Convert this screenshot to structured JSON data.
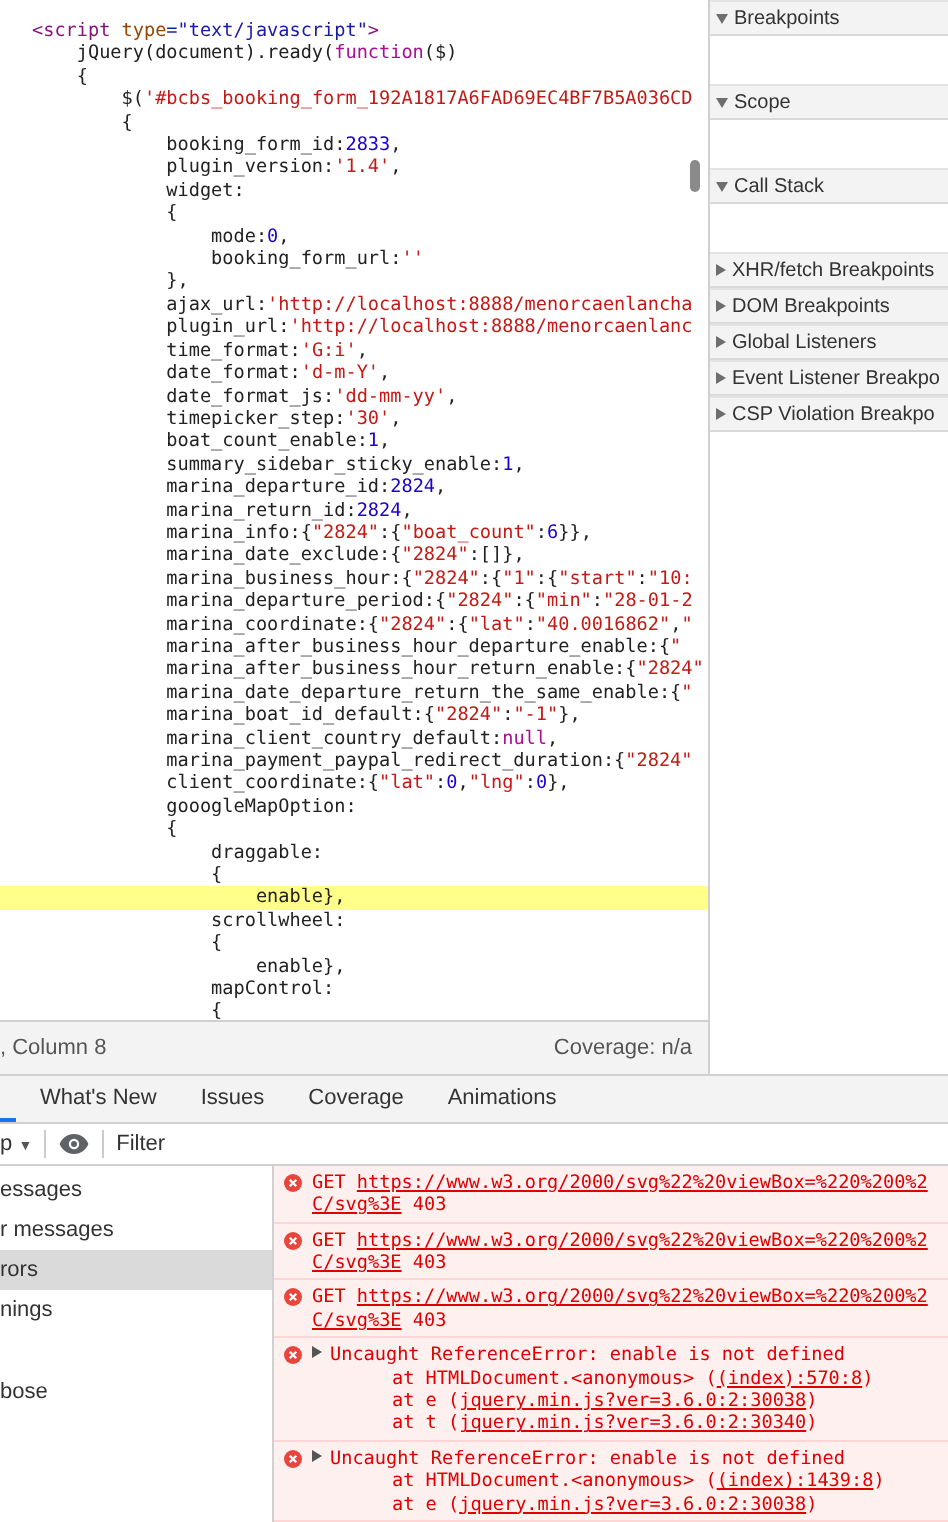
{
  "editor": {
    "lines": [
      {
        "highlighted": false,
        "tokens": [
          {
            "kind": "tag",
            "text": "<script "
          },
          {
            "kind": "attr",
            "text": "type"
          },
          {
            "kind": "attrval",
            "text": "=\"text/javascript\""
          },
          {
            "kind": "tag",
            "text": ">"
          }
        ]
      },
      {
        "highlighted": false,
        "tokens": [
          {
            "kind": "plain",
            "text": "    jQuery(document).ready("
          },
          {
            "kind": "kw",
            "text": "function"
          },
          {
            "kind": "plain",
            "text": "($)"
          }
        ]
      },
      {
        "highlighted": false,
        "tokens": [
          {
            "kind": "plain",
            "text": "    {"
          }
        ]
      },
      {
        "highlighted": false,
        "tokens": [
          {
            "kind": "plain",
            "text": "        $("
          },
          {
            "kind": "str",
            "text": "'#bcbs_booking_form_192A1817A6FAD69EC4BF7B5A036CD"
          }
        ]
      },
      {
        "highlighted": false,
        "tokens": [
          {
            "kind": "plain",
            "text": "        {"
          }
        ]
      },
      {
        "highlighted": false,
        "tokens": [
          {
            "kind": "plain",
            "text": "            booking_form_id:"
          },
          {
            "kind": "num",
            "text": "2833"
          },
          {
            "kind": "plain",
            "text": ","
          }
        ]
      },
      {
        "highlighted": false,
        "tokens": [
          {
            "kind": "plain",
            "text": "            plugin_version:"
          },
          {
            "kind": "str",
            "text": "'1.4'"
          },
          {
            "kind": "plain",
            "text": ","
          }
        ]
      },
      {
        "highlighted": false,
        "tokens": [
          {
            "kind": "plain",
            "text": "            widget:"
          }
        ]
      },
      {
        "highlighted": false,
        "tokens": [
          {
            "kind": "plain",
            "text": "            {"
          }
        ]
      },
      {
        "highlighted": false,
        "tokens": [
          {
            "kind": "plain",
            "text": "                mode:"
          },
          {
            "kind": "num",
            "text": "0"
          },
          {
            "kind": "plain",
            "text": ","
          }
        ]
      },
      {
        "highlighted": false,
        "tokens": [
          {
            "kind": "plain",
            "text": "                booking_form_url:"
          },
          {
            "kind": "str",
            "text": "''"
          }
        ]
      },
      {
        "highlighted": false,
        "tokens": [
          {
            "kind": "plain",
            "text": "            },"
          }
        ]
      },
      {
        "highlighted": false,
        "tokens": [
          {
            "kind": "plain",
            "text": "            ajax_url:"
          },
          {
            "kind": "str",
            "text": "'http://localhost:8888/menorcaenlancha"
          }
        ]
      },
      {
        "highlighted": false,
        "tokens": [
          {
            "kind": "plain",
            "text": "            plugin_url:"
          },
          {
            "kind": "str",
            "text": "'http://localhost:8888/menorcaenlanc"
          }
        ]
      },
      {
        "highlighted": false,
        "tokens": [
          {
            "kind": "plain",
            "text": "            time_format:"
          },
          {
            "kind": "str",
            "text": "'G:i'"
          },
          {
            "kind": "plain",
            "text": ","
          }
        ]
      },
      {
        "highlighted": false,
        "tokens": [
          {
            "kind": "plain",
            "text": "            date_format:"
          },
          {
            "kind": "str",
            "text": "'d-m-Y'"
          },
          {
            "kind": "plain",
            "text": ","
          }
        ]
      },
      {
        "highlighted": false,
        "tokens": [
          {
            "kind": "plain",
            "text": "            date_format_js:"
          },
          {
            "kind": "str",
            "text": "'dd-mm-yy'"
          },
          {
            "kind": "plain",
            "text": ","
          }
        ]
      },
      {
        "highlighted": false,
        "tokens": [
          {
            "kind": "plain",
            "text": "            timepicker_step:"
          },
          {
            "kind": "str",
            "text": "'30'"
          },
          {
            "kind": "plain",
            "text": ","
          }
        ]
      },
      {
        "highlighted": false,
        "tokens": [
          {
            "kind": "plain",
            "text": "            boat_count_enable:"
          },
          {
            "kind": "num",
            "text": "1"
          },
          {
            "kind": "plain",
            "text": ","
          }
        ]
      },
      {
        "highlighted": false,
        "tokens": [
          {
            "kind": "plain",
            "text": "            summary_sidebar_sticky_enable:"
          },
          {
            "kind": "num",
            "text": "1"
          },
          {
            "kind": "plain",
            "text": ","
          }
        ]
      },
      {
        "highlighted": false,
        "tokens": [
          {
            "kind": "plain",
            "text": "            marina_departure_id:"
          },
          {
            "kind": "num",
            "text": "2824"
          },
          {
            "kind": "plain",
            "text": ","
          }
        ]
      },
      {
        "highlighted": false,
        "tokens": [
          {
            "kind": "plain",
            "text": "            marina_return_id:"
          },
          {
            "kind": "num",
            "text": "2824"
          },
          {
            "kind": "plain",
            "text": ","
          }
        ]
      },
      {
        "highlighted": false,
        "tokens": [
          {
            "kind": "plain",
            "text": "            marina_info:{"
          },
          {
            "kind": "str",
            "text": "\"2824\""
          },
          {
            "kind": "plain",
            "text": ":{"
          },
          {
            "kind": "str",
            "text": "\"boat_count\""
          },
          {
            "kind": "plain",
            "text": ":"
          },
          {
            "kind": "num",
            "text": "6"
          },
          {
            "kind": "plain",
            "text": "}},"
          }
        ]
      },
      {
        "highlighted": false,
        "tokens": [
          {
            "kind": "plain",
            "text": "            marina_date_exclude:{"
          },
          {
            "kind": "str",
            "text": "\"2824\""
          },
          {
            "kind": "plain",
            "text": ":[]},"
          }
        ]
      },
      {
        "highlighted": false,
        "tokens": [
          {
            "kind": "plain",
            "text": "            marina_business_hour:{"
          },
          {
            "kind": "str",
            "text": "\"2824\""
          },
          {
            "kind": "plain",
            "text": ":{"
          },
          {
            "kind": "str",
            "text": "\"1\""
          },
          {
            "kind": "plain",
            "text": ":{"
          },
          {
            "kind": "str",
            "text": "\"start\""
          },
          {
            "kind": "plain",
            "text": ":"
          },
          {
            "kind": "str",
            "text": "\"10:"
          }
        ]
      },
      {
        "highlighted": false,
        "tokens": [
          {
            "kind": "plain",
            "text": "            marina_departure_period:{"
          },
          {
            "kind": "str",
            "text": "\"2824\""
          },
          {
            "kind": "plain",
            "text": ":{"
          },
          {
            "kind": "str",
            "text": "\"min\""
          },
          {
            "kind": "plain",
            "text": ":"
          },
          {
            "kind": "str",
            "text": "\"28-01-2"
          }
        ]
      },
      {
        "highlighted": false,
        "tokens": [
          {
            "kind": "plain",
            "text": "            marina_coordinate:{"
          },
          {
            "kind": "str",
            "text": "\"2824\""
          },
          {
            "kind": "plain",
            "text": ":{"
          },
          {
            "kind": "str",
            "text": "\"lat\""
          },
          {
            "kind": "plain",
            "text": ":"
          },
          {
            "kind": "str",
            "text": "\"40.0016862\""
          },
          {
            "kind": "plain",
            "text": ","
          },
          {
            "kind": "str",
            "text": "\""
          }
        ]
      },
      {
        "highlighted": false,
        "tokens": [
          {
            "kind": "plain",
            "text": "            marina_after_business_hour_departure_enable:{"
          },
          {
            "kind": "str",
            "text": "\""
          }
        ]
      },
      {
        "highlighted": false,
        "tokens": [
          {
            "kind": "plain",
            "text": "            marina_after_business_hour_return_enable:{"
          },
          {
            "kind": "str",
            "text": "\"2824\""
          }
        ]
      },
      {
        "highlighted": false,
        "tokens": [
          {
            "kind": "plain",
            "text": "            marina_date_departure_return_the_same_enable:{"
          },
          {
            "kind": "str",
            "text": "\""
          }
        ]
      },
      {
        "highlighted": false,
        "tokens": [
          {
            "kind": "plain",
            "text": "            marina_boat_id_default:{"
          },
          {
            "kind": "str",
            "text": "\"2824\""
          },
          {
            "kind": "plain",
            "text": ":"
          },
          {
            "kind": "str",
            "text": "\"-1\""
          },
          {
            "kind": "plain",
            "text": "},"
          }
        ]
      },
      {
        "highlighted": false,
        "tokens": [
          {
            "kind": "plain",
            "text": "            marina_client_country_default:"
          },
          {
            "kind": "kw",
            "text": "null"
          },
          {
            "kind": "plain",
            "text": ","
          }
        ]
      },
      {
        "highlighted": false,
        "tokens": [
          {
            "kind": "plain",
            "text": "            marina_payment_paypal_redirect_duration:{"
          },
          {
            "kind": "str",
            "text": "\"2824\""
          }
        ]
      },
      {
        "highlighted": false,
        "tokens": [
          {
            "kind": "plain",
            "text": "            client_coordinate:{"
          },
          {
            "kind": "str",
            "text": "\"lat\""
          },
          {
            "kind": "plain",
            "text": ":"
          },
          {
            "kind": "num",
            "text": "0"
          },
          {
            "kind": "plain",
            "text": ","
          },
          {
            "kind": "str",
            "text": "\"lng\""
          },
          {
            "kind": "plain",
            "text": ":"
          },
          {
            "kind": "num",
            "text": "0"
          },
          {
            "kind": "plain",
            "text": "},"
          }
        ]
      },
      {
        "highlighted": false,
        "tokens": [
          {
            "kind": "plain",
            "text": "            gooogleMapOption:"
          }
        ]
      },
      {
        "highlighted": false,
        "tokens": [
          {
            "kind": "plain",
            "text": "            {"
          }
        ]
      },
      {
        "highlighted": false,
        "tokens": [
          {
            "kind": "plain",
            "text": "                draggable:"
          }
        ]
      },
      {
        "highlighted": false,
        "tokens": [
          {
            "kind": "plain",
            "text": "                {"
          }
        ]
      },
      {
        "highlighted": true,
        "tokens": [
          {
            "kind": "plain",
            "text": "                    enable},"
          }
        ]
      },
      {
        "highlighted": false,
        "tokens": [
          {
            "kind": "plain",
            "text": "                scrollwheel:"
          }
        ]
      },
      {
        "highlighted": false,
        "tokens": [
          {
            "kind": "plain",
            "text": "                {"
          }
        ]
      },
      {
        "highlighted": false,
        "tokens": [
          {
            "kind": "plain",
            "text": "                    enable},"
          }
        ]
      },
      {
        "highlighted": false,
        "tokens": [
          {
            "kind": "plain",
            "text": "                mapControl:"
          }
        ]
      },
      {
        "highlighted": false,
        "tokens": [
          {
            "kind": "plain",
            "text": "                {"
          }
        ]
      }
    ]
  },
  "status_bar": {
    "position": ", Column 8",
    "coverage": "Coverage: n/a"
  },
  "debugger_sidebar": [
    {
      "label": "Breakpoints",
      "expanded": true
    },
    {
      "label": "Scope",
      "expanded": true
    },
    {
      "label": "Call Stack",
      "expanded": true
    },
    {
      "label": "XHR/fetch Breakpoints",
      "expanded": false
    },
    {
      "label": "DOM Breakpoints",
      "expanded": false
    },
    {
      "label": "Global Listeners",
      "expanded": false
    },
    {
      "label": "Event Listener Breakpo",
      "expanded": false
    },
    {
      "label": "CSP Violation Breakpo",
      "expanded": false
    }
  ],
  "drawer_tabs": [
    {
      "label": "What's New",
      "selected": false
    },
    {
      "label": "Issues",
      "selected": false
    },
    {
      "label": "Coverage",
      "selected": false
    },
    {
      "label": "Animations",
      "selected": false
    }
  ],
  "console_toolbar": {
    "context": "p",
    "caret": "▼",
    "filter_placeholder": "Filter"
  },
  "console_sidebar": [
    {
      "label": "essages",
      "selected": false
    },
    {
      "label": "r messages",
      "selected": false
    },
    {
      "label": "rors",
      "selected": true
    },
    {
      "label": "nings",
      "selected": false
    },
    {
      "label": "bose",
      "selected": false
    }
  ],
  "console_messages": [
    {
      "kind": "network",
      "method": "GET",
      "url": "https://www.w3.org/2000/svg%22%20viewBox=%220%200%2",
      "url_rest": "C/svg%3E",
      "status": "403"
    },
    {
      "kind": "network",
      "method": "GET",
      "url": "https://www.w3.org/2000/svg%22%20viewBox=%220%200%2",
      "url_rest": "C/svg%3E",
      "status": "403"
    },
    {
      "kind": "network",
      "method": "GET",
      "url": "https://www.w3.org/2000/svg%22%20viewBox=%220%200%2",
      "url_rest": "C/svg%3E",
      "status": "403"
    },
    {
      "kind": "exception",
      "message": "Uncaught ReferenceError: enable is not defined",
      "stack": [
        {
          "text": "at HTMLDocument.<anonymous> (",
          "link": "(index):570:8",
          "end": ")"
        },
        {
          "text": "at e (",
          "link": "jquery.min.js?ver=3.6.0:2:30038",
          "end": ")"
        },
        {
          "text": "at t (",
          "link": "jquery.min.js?ver=3.6.0:2:30340",
          "end": ")"
        }
      ]
    },
    {
      "kind": "exception",
      "message": "Uncaught ReferenceError: enable is not defined",
      "stack": [
        {
          "text": "at HTMLDocument.<anonymous> (",
          "link": "(index):1439:8",
          "end": ")"
        },
        {
          "text": "at e (",
          "link": "jquery.min.js?ver=3.6.0:2:30038",
          "end": ")"
        }
      ]
    }
  ]
}
